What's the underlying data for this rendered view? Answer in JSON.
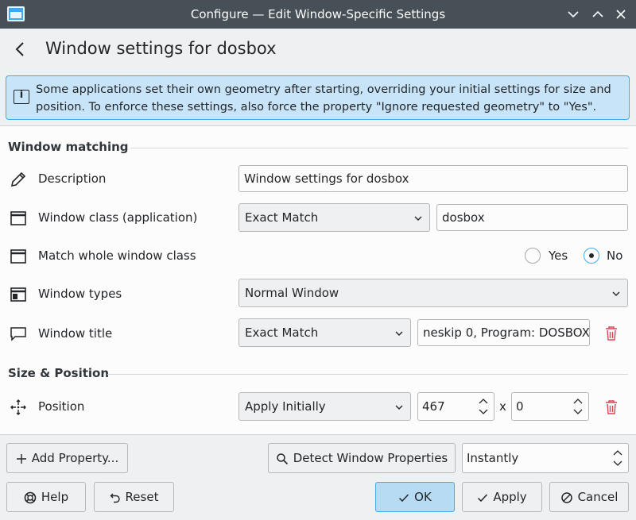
{
  "window": {
    "title": "Configure — Edit Window-Specific Settings",
    "controls": [
      "minimize-icon",
      "maximize-icon",
      "close-icon"
    ]
  },
  "header": {
    "title": "Window settings for dosbox"
  },
  "banner": {
    "text": "Some applications set their own geometry after starting, overriding your initial settings for size and position. To enforce these settings, also force the property \"Ignore requested geometry\" to \"Yes\"."
  },
  "sections": {
    "matching": "Window matching",
    "size_position": "Size & Position"
  },
  "rows": {
    "description": {
      "label": "Description",
      "value": "Window settings for dosbox"
    },
    "window_class": {
      "label": "Window class (application)",
      "match": "Exact Match",
      "value": "dosbox"
    },
    "whole_class": {
      "label": "Match whole window class",
      "yes": "Yes",
      "no": "No",
      "selected": "No"
    },
    "window_types": {
      "label": "Window types",
      "value": "Normal Window"
    },
    "window_title": {
      "label": "Window title",
      "match": "Exact Match",
      "value": "neskip 0, Program: DOSBOX"
    },
    "position": {
      "label": "Position",
      "policy": "Apply Initially",
      "x": "467",
      "separator": "x",
      "y": "0"
    }
  },
  "footer": {
    "add_property": "Add Property...",
    "detect": "Detect Window Properties",
    "delay": "Instantly",
    "help": "Help",
    "reset": "Reset",
    "ok": "OK",
    "apply": "Apply",
    "cancel": "Cancel"
  },
  "colors": {
    "accent": "#3daee9",
    "banner_bg": "#c7e4f9",
    "titlebar": "#475057",
    "delete": "#da4453"
  }
}
